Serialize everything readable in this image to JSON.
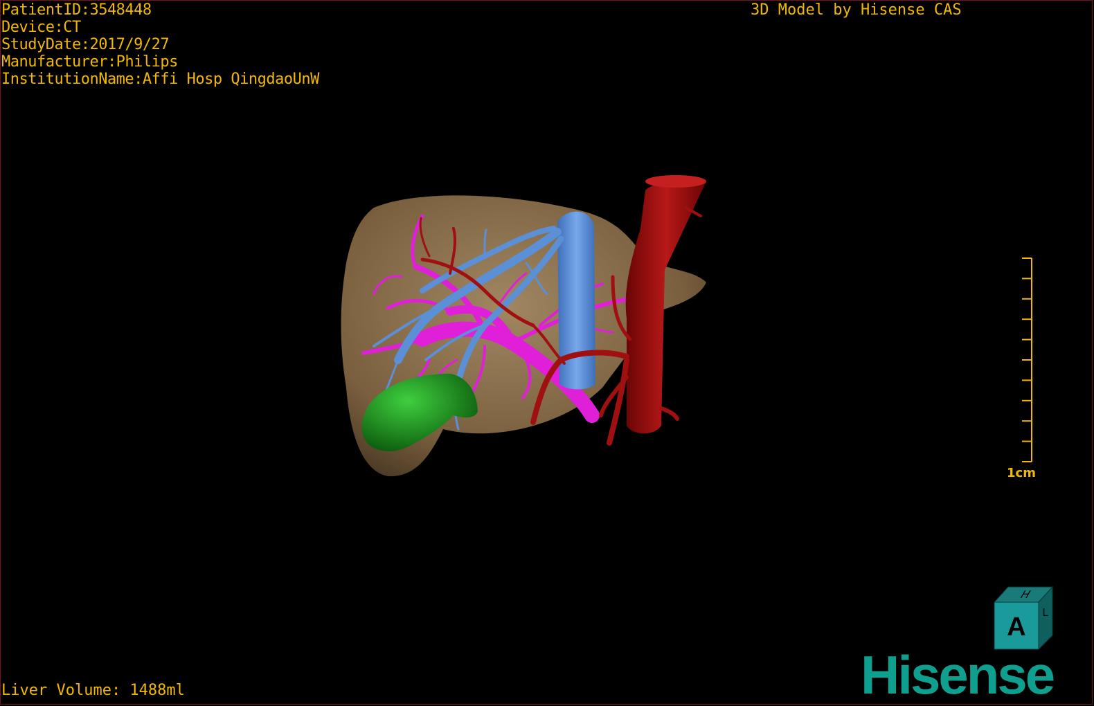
{
  "overlay": {
    "patient_id": "PatientID:3548448",
    "device": "Device:CT",
    "study_date": "StudyDate:2017/9/27",
    "manufacturer": "Manufacturer:Philips",
    "institution": "InstitutionName:Affi Hosp QingdaoUnW",
    "credit": "3D Model by Hisense CAS",
    "liver_volume": "Liver Volume: 1488ml"
  },
  "scale_bar": {
    "label": "1cm",
    "ticks": 10
  },
  "orientation_cube": {
    "front": "A",
    "top": "H",
    "side": "L"
  },
  "brand": {
    "logo": "Hisense"
  },
  "colors": {
    "text": "#f2b800",
    "liver": "#8a6e4a",
    "hepatic_vein": "#5b8fd6",
    "portal_vein": "#e020d8",
    "artery_aorta": "#a01010",
    "gallbladder": "#1a8f1a",
    "brand": "#0f9f8f"
  }
}
